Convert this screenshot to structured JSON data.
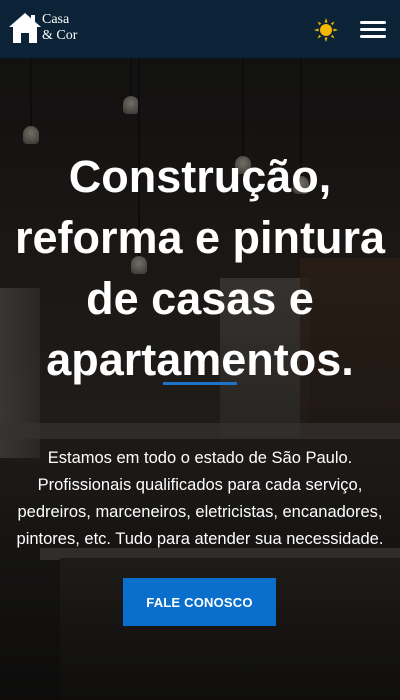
{
  "header": {
    "logo_line1": "Casa",
    "logo_line2": "& Cor",
    "theme_icon": "sun-icon",
    "menu_icon": "hamburger-menu-icon"
  },
  "hero": {
    "headline": "Construção, reforma e pintura de casas e apartamentos.",
    "description": "Estamos em todo o estado de São Paulo. Profissionais qualificados para cada serviço, pedreiros, marceneiros, eletricistas, encanadores, pintores, etc. Tudo para atender sua necessidade.",
    "cta_label": "FALE CONOSCO"
  },
  "colors": {
    "header_bg": "#0c2236",
    "accent": "#0a6fcc",
    "sun": "#f5b800"
  }
}
